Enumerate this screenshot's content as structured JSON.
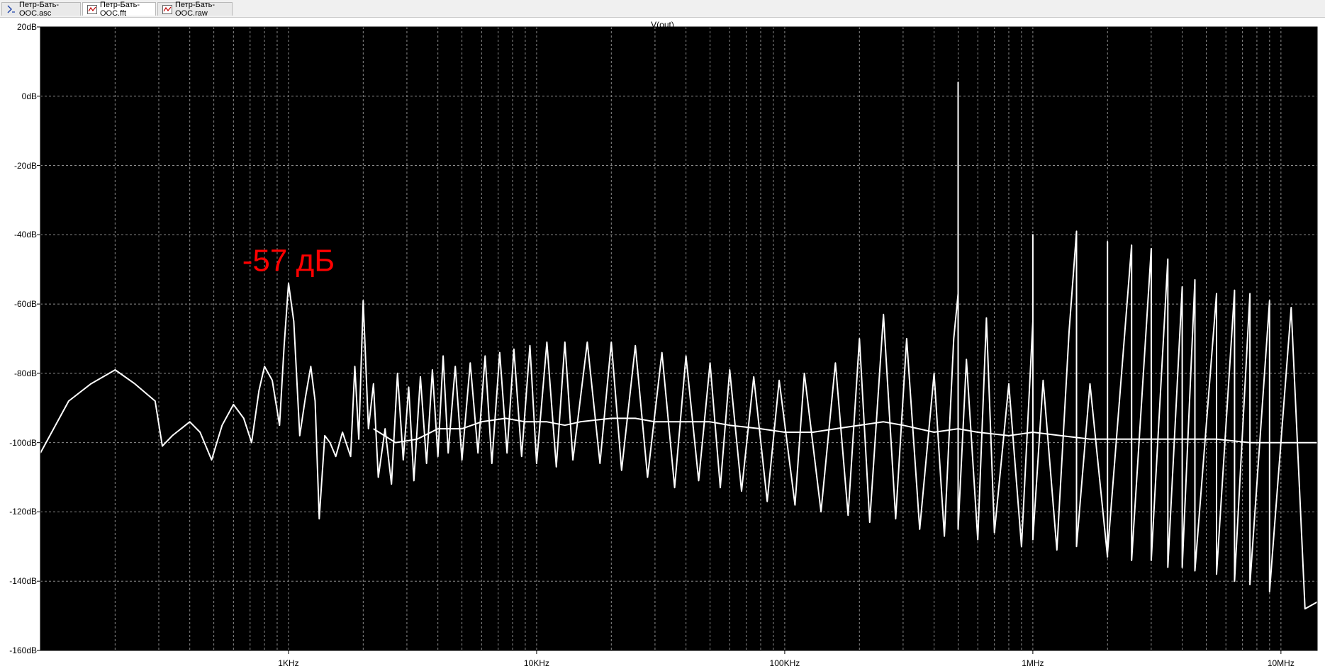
{
  "tabs": [
    {
      "label": "Петр-Бать-ООС.asc",
      "icon": "schematic-icon",
      "active": false
    },
    {
      "label": "Петр-Бать-ООС.fft",
      "icon": "waveform-icon",
      "active": true
    },
    {
      "label": "Петр-Бать-ООС.raw",
      "icon": "waveform-icon",
      "active": false
    }
  ],
  "colors": {
    "plot_background": "#000000",
    "trace": "#ffffff",
    "grid": "#8c8c8c",
    "annotation": "#ff0000"
  },
  "chart_data": {
    "type": "line",
    "title": "V(out)",
    "x_scale": "log",
    "xlim": [
      100,
      14000000
    ],
    "ylim": [
      -160,
      20
    ],
    "y_ticks": [
      20,
      0,
      -20,
      -40,
      -60,
      -80,
      -100,
      -120,
      -140,
      -160
    ],
    "y_tick_labels": [
      "20dB",
      "0dB",
      "-20dB",
      "-40dB",
      "-60dB",
      "-80dB",
      "-100dB",
      "-120dB",
      "-140dB",
      "-160dB"
    ],
    "x_ticks": [
      1000,
      10000,
      100000,
      1000000,
      10000000
    ],
    "x_tick_labels": [
      "1KHz",
      "10KHz",
      "100KHz",
      "1MHz",
      "10MHz"
    ],
    "grid": true,
    "annotation": {
      "text": "-57 дБ",
      "x": 1000,
      "y": -57
    },
    "series": [
      {
        "points": [
          [
            100,
            -103
          ],
          [
            130,
            -88
          ],
          [
            160,
            -83
          ],
          [
            200,
            -79
          ],
          [
            240,
            -83
          ],
          [
            290,
            -88
          ],
          [
            310,
            -101
          ],
          [
            340,
            -98
          ],
          [
            400,
            -94
          ],
          [
            440,
            -97
          ],
          [
            490,
            -105
          ],
          [
            540,
            -95
          ],
          [
            600,
            -89
          ],
          [
            660,
            -93
          ],
          [
            710,
            -100
          ],
          [
            760,
            -85
          ],
          [
            800,
            -78
          ],
          [
            860,
            -82
          ],
          [
            920,
            -95
          ],
          [
            960,
            -72
          ],
          [
            1000,
            -54
          ],
          [
            1050,
            -65
          ],
          [
            1110,
            -98
          ],
          [
            1170,
            -87
          ],
          [
            1230,
            -78
          ],
          [
            1280,
            -88
          ],
          [
            1330,
            -122
          ],
          [
            1400,
            -98
          ],
          [
            1470,
            -100
          ],
          [
            1550,
            -104
          ],
          [
            1650,
            -97
          ],
          [
            1780,
            -104
          ],
          [
            1850,
            -78
          ],
          [
            1920,
            -99
          ],
          [
            2000,
            -59
          ],
          [
            2100,
            -96
          ],
          [
            2200,
            -83
          ],
          [
            2300,
            -110
          ],
          [
            2450,
            -96
          ],
          [
            2600,
            -112
          ],
          [
            2750,
            -80
          ],
          [
            2900,
            -105
          ],
          [
            3050,
            -84
          ],
          [
            3200,
            -111
          ],
          [
            3400,
            -81
          ],
          [
            3600,
            -106
          ],
          [
            3800,
            -79
          ],
          [
            4000,
            -104
          ],
          [
            4200,
            -75
          ],
          [
            4400,
            -103
          ],
          [
            4700,
            -78
          ],
          [
            5000,
            -105
          ],
          [
            5400,
            -77
          ],
          [
            5800,
            -103
          ],
          [
            6200,
            -75
          ],
          [
            6600,
            -106
          ],
          [
            7100,
            -74
          ],
          [
            7600,
            -103
          ],
          [
            8100,
            -73
          ],
          [
            8700,
            -104
          ],
          [
            9400,
            -72
          ],
          [
            10000,
            -106
          ],
          [
            11000,
            -71
          ],
          [
            12000,
            -107
          ],
          [
            13000,
            -71
          ],
          [
            14000,
            -105
          ],
          [
            16000,
            -71
          ],
          [
            18000,
            -106
          ],
          [
            20000,
            -71
          ],
          [
            22000,
            -108
          ],
          [
            25000,
            -72
          ],
          [
            28000,
            -110
          ],
          [
            32000,
            -74
          ],
          [
            36000,
            -113
          ],
          [
            40000,
            -75
          ],
          [
            45000,
            -111
          ],
          [
            50000,
            -77
          ],
          [
            55000,
            -113
          ],
          [
            60000,
            -79
          ],
          [
            67000,
            -114
          ],
          [
            75000,
            -81
          ],
          [
            85000,
            -117
          ],
          [
            95000,
            -82
          ],
          [
            110000,
            -118
          ],
          [
            120000,
            -80
          ],
          [
            140000,
            -120
          ],
          [
            160000,
            -77
          ],
          [
            180000,
            -121
          ],
          [
            200000,
            -70
          ],
          [
            220000,
            -123
          ],
          [
            250000,
            -63
          ],
          [
            280000,
            -122
          ],
          [
            310000,
            -70
          ],
          [
            350000,
            -125
          ],
          [
            400000,
            -80
          ],
          [
            440000,
            -127
          ],
          [
            480000,
            -70
          ],
          [
            500000,
            -57
          ],
          [
            500000,
            4
          ],
          [
            500000,
            -125
          ],
          [
            540000,
            -76
          ],
          [
            600000,
            -128
          ],
          [
            650000,
            -64
          ],
          [
            700000,
            -126
          ],
          [
            800000,
            -83
          ],
          [
            900000,
            -130
          ],
          [
            1000000,
            -65
          ],
          [
            1000000,
            -40
          ],
          [
            1000000,
            -128
          ],
          [
            1100000,
            -82
          ],
          [
            1250000,
            -131
          ],
          [
            1400000,
            -68
          ],
          [
            1500000,
            -39
          ],
          [
            1500000,
            -130
          ],
          [
            1700000,
            -83
          ],
          [
            2000000,
            -133
          ],
          [
            2000000,
            -42
          ],
          [
            2000000,
            -132
          ],
          [
            2500000,
            -43
          ],
          [
            2500000,
            -134
          ],
          [
            3000000,
            -44
          ],
          [
            3000000,
            -134
          ],
          [
            3500000,
            -47
          ],
          [
            3500000,
            -136
          ],
          [
            4000000,
            -55
          ],
          [
            4000000,
            -136
          ],
          [
            4500000,
            -53
          ],
          [
            4500000,
            -137
          ],
          [
            5500000,
            -57
          ],
          [
            5500000,
            -138
          ],
          [
            6500000,
            -56
          ],
          [
            6500000,
            -140
          ],
          [
            7500000,
            -57
          ],
          [
            7500000,
            -141
          ],
          [
            9000000,
            -59
          ],
          [
            9000000,
            -143
          ],
          [
            11000000,
            -61
          ],
          [
            12500000,
            -148
          ],
          [
            14000000,
            -146
          ]
        ]
      },
      {
        "points": [
          [
            2200,
            -96
          ],
          [
            2700,
            -100
          ],
          [
            3300,
            -99
          ],
          [
            4000,
            -96
          ],
          [
            5000,
            -96
          ],
          [
            6000,
            -94
          ],
          [
            7500,
            -93
          ],
          [
            9000,
            -94
          ],
          [
            11000,
            -94
          ],
          [
            13000,
            -95
          ],
          [
            15000,
            -94
          ],
          [
            20000,
            -93
          ],
          [
            25000,
            -93
          ],
          [
            30000,
            -94
          ],
          [
            40000,
            -94
          ],
          [
            50000,
            -94
          ],
          [
            60000,
            -95
          ],
          [
            80000,
            -96
          ],
          [
            100000,
            -97
          ],
          [
            130000,
            -97
          ],
          [
            160000,
            -96
          ],
          [
            200000,
            -95
          ],
          [
            250000,
            -94
          ],
          [
            300000,
            -95
          ],
          [
            400000,
            -97
          ],
          [
            500000,
            -96
          ],
          [
            600000,
            -97
          ],
          [
            800000,
            -98
          ],
          [
            1000000,
            -97
          ],
          [
            1300000,
            -98
          ],
          [
            1700000,
            -99
          ],
          [
            2200000,
            -99
          ],
          [
            3000000,
            -99
          ],
          [
            4000000,
            -99
          ],
          [
            5500000,
            -99
          ],
          [
            7500000,
            -100
          ],
          [
            10000000,
            -100
          ],
          [
            14000000,
            -100
          ]
        ]
      }
    ]
  }
}
